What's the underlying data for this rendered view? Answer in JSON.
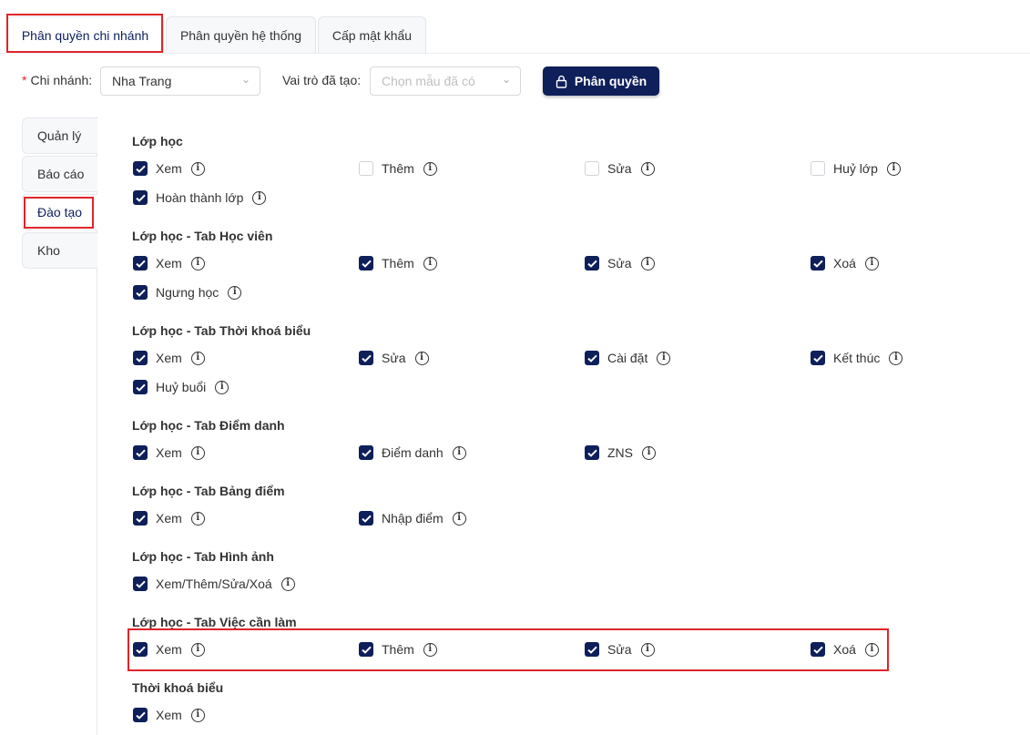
{
  "tabs": [
    "Phân quyền chi nhánh",
    "Phân quyền hệ thống",
    "Cấp mật khẩu"
  ],
  "filters": {
    "branch_label": "Chi nhánh",
    "branch_required_mark": "*",
    "branch_value": "Nha Trang",
    "role_label": "Vai trò đã tạo",
    "role_placeholder": "Chọn mẫu đã có",
    "submit_label": "Phân quyền"
  },
  "sidebar": [
    "Quản lý",
    "Báo cáo",
    "Đào tạo",
    "Kho"
  ],
  "colors": {
    "primary": "#0e1f5a",
    "highlight": "#e0242a"
  },
  "sections": [
    {
      "title": "Lớp học",
      "items": [
        {
          "label": "Xem",
          "checked": true
        },
        {
          "label": "Thêm",
          "checked": false
        },
        {
          "label": "Sửa",
          "checked": false
        },
        {
          "label": "Huỷ lớp",
          "checked": false
        },
        {
          "label": "Hoàn thành lớp",
          "checked": true
        }
      ]
    },
    {
      "title": "Lớp học - Tab Học viên",
      "items": [
        {
          "label": "Xem",
          "checked": true
        },
        {
          "label": "Thêm",
          "checked": true
        },
        {
          "label": "Sửa",
          "checked": true
        },
        {
          "label": "Xoá",
          "checked": true
        },
        {
          "label": "Ngưng học",
          "checked": true
        }
      ]
    },
    {
      "title": "Lớp học - Tab Thời khoá biểu",
      "items": [
        {
          "label": "Xem",
          "checked": true
        },
        {
          "label": "Sửa",
          "checked": true
        },
        {
          "label": "Cài đặt",
          "checked": true
        },
        {
          "label": "Kết thúc",
          "checked": true
        },
        {
          "label": "Huỷ buổi",
          "checked": true
        }
      ]
    },
    {
      "title": "Lớp học - Tab Điểm danh",
      "items": [
        {
          "label": "Xem",
          "checked": true
        },
        {
          "label": "Điểm danh",
          "checked": true
        },
        {
          "label": "ZNS",
          "checked": true
        }
      ]
    },
    {
      "title": "Lớp học - Tab Bảng điểm",
      "items": [
        {
          "label": "Xem",
          "checked": true
        },
        {
          "label": "Nhập điểm",
          "checked": true
        }
      ]
    },
    {
      "title": "Lớp học - Tab Hình ảnh",
      "items": [
        {
          "label": "Xem/Thêm/Sửa/Xoá",
          "checked": true
        }
      ]
    },
    {
      "title": "Lớp học - Tab Việc cần làm",
      "items": [
        {
          "label": "Xem",
          "checked": true
        },
        {
          "label": "Thêm",
          "checked": true
        },
        {
          "label": "Sửa",
          "checked": true
        },
        {
          "label": "Xoá",
          "checked": true
        }
      ]
    },
    {
      "title": "Thời khoá biểu",
      "items": [
        {
          "label": "Xem",
          "checked": true
        }
      ]
    }
  ]
}
